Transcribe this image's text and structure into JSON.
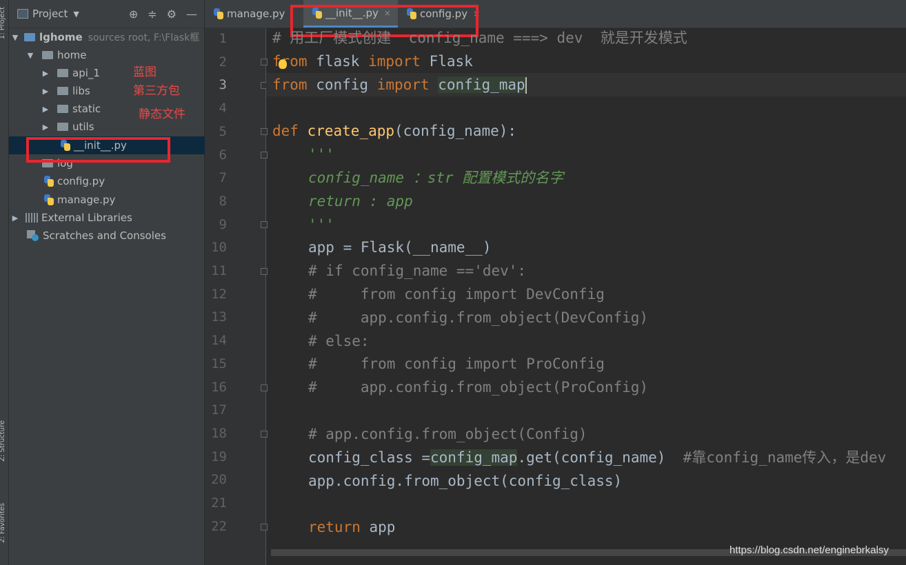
{
  "side_strip": {
    "project_tab": "1: Project",
    "structure_tab": "Z: Structure",
    "favorites_tab": "2: Favorites"
  },
  "project_panel": {
    "title": "Project",
    "dropdown_icon": "chevron-down-icon",
    "toolbar_icons": [
      "locate-icon",
      "collapse-all-icon",
      "gear-icon",
      "minimize-icon"
    ]
  },
  "tree": {
    "root_name": "lghome",
    "root_hint": "sources root,  F:\\Flask框",
    "home": "home",
    "api": "api_1",
    "libs": "libs",
    "static": "static",
    "utils": "utils",
    "init": "__init__.py",
    "log": "log",
    "config": "config.py",
    "manage": "manage.py",
    "external": "External Libraries",
    "scratches": "Scratches and Consoles"
  },
  "annotations": {
    "blueprint": "蓝图",
    "third_party": "第三方包",
    "static_files": "静态文件"
  },
  "tabs": {
    "manage": "manage.py",
    "init": "__init__.py",
    "config": "config.py",
    "close_glyph": "×"
  },
  "line_numbers": [
    "1",
    "2",
    "3",
    "4",
    "5",
    "6",
    "7",
    "8",
    "9",
    "10",
    "11",
    "12",
    "13",
    "14",
    "15",
    "16",
    "17",
    "18",
    "19",
    "20",
    "21",
    "22"
  ],
  "current_line": 3,
  "code": {
    "l1": "# 用工厂模式创建  config_name ===> dev  就是开发模式",
    "l2_kw1": "from",
    "l2_mod": " flask ",
    "l2_kw2": "import",
    "l2_name": " Flask",
    "l3_kw1": "from",
    "l3_mod": " config ",
    "l3_kw2": "import",
    "l3_name": "config_map",
    "l5_kw": "def",
    "l5_fn": "create_app",
    "l5_rest": "(config_name):",
    "l6": "'''",
    "l7": "config_name ：str 配置模式的名字",
    "l8": "return : app",
    "l9": "'''",
    "l10": "app = Flask(__name__)",
    "l11": "# if config_name =='dev':",
    "l12": "#     from config import DevConfig",
    "l13": "#     app.config.from_object(DevConfig)",
    "l14": "# else:",
    "l15": "#     from config import ProConfig",
    "l16": "#     app.config.from_object(ProConfig)",
    "l18": "# app.config.from_object(Config)",
    "l19_a": "config_class =",
    "l19_b": "config_map",
    "l19_c": ".get(config_name)  ",
    "l19_cm": "#靠config_name传入，是dev",
    "l20": "app.config.from_object(config_class)",
    "l22_kw": "return",
    "l22_rest": " app"
  },
  "watermark": "https://blog.csdn.net/enginebrkalsy",
  "colors": {
    "annotation_red": "#e8262f",
    "keyword": "#cc7832",
    "function": "#ffc66d",
    "docstring": "#629755",
    "comment": "#808080",
    "selection": "#0d293e"
  }
}
